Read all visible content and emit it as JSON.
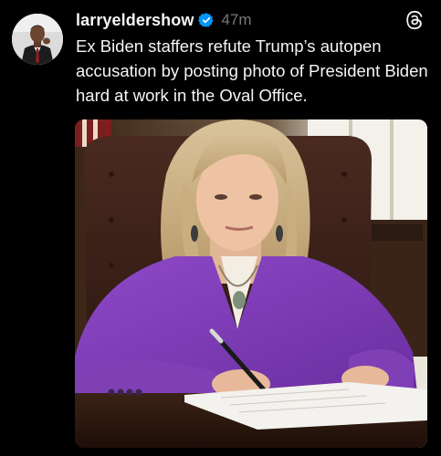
{
  "post": {
    "username": "larryeldershow",
    "verified": true,
    "timestamp": "47m",
    "caption": "Ex Biden staffers refute Trump’s autopen accusation by posting photo of President Biden hard at work in the Oval Office.",
    "avatar_icon": "profile-photo",
    "verified_icon": "verified-badge-icon",
    "app_icon": "threads-logo-icon",
    "media_description_icon": "post-photo"
  },
  "colors": {
    "background": "#000000",
    "text": "#f3f5f7",
    "muted": "#777777",
    "verified": "#0095f6"
  }
}
